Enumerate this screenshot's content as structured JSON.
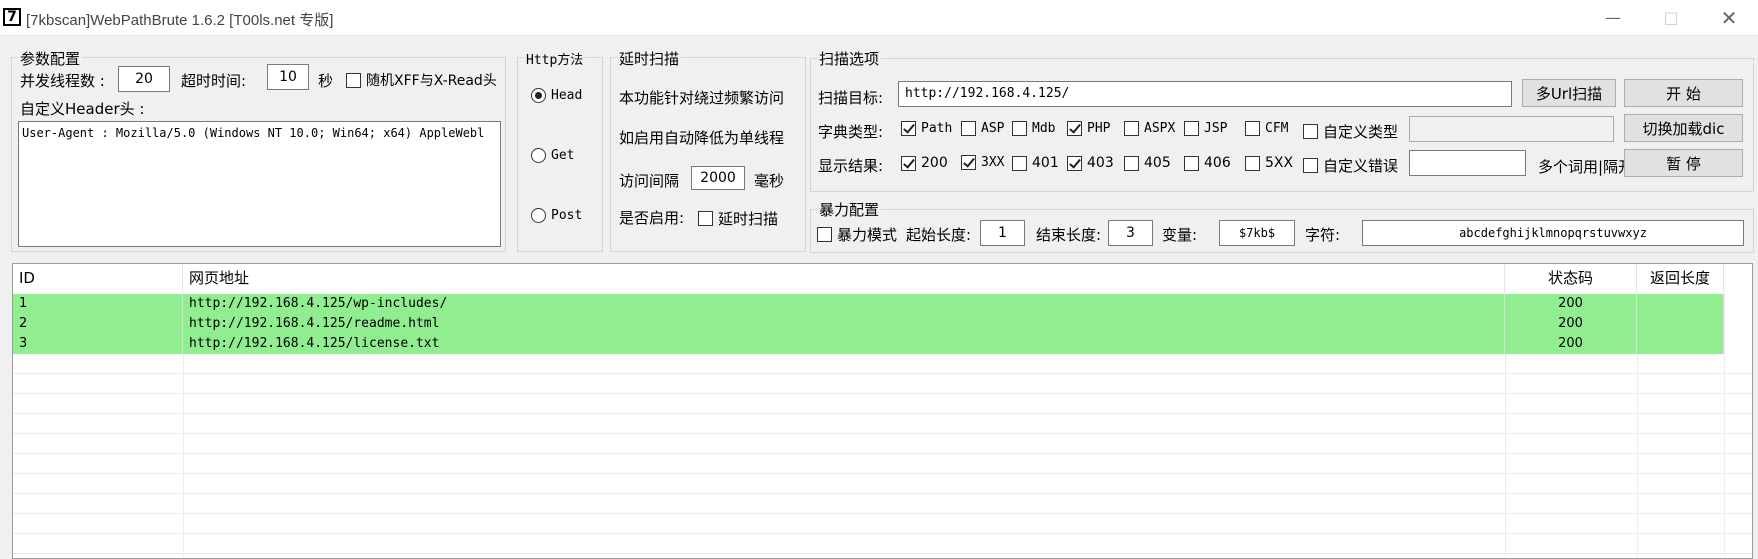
{
  "window": {
    "app_icon": "7",
    "title": "[7kbscan]WebPathBrute 1.6.2 [T00ls.net 专版]"
  },
  "params": {
    "group_label": "参数配置",
    "threads_label": "并发线程数 :",
    "threads_value": "20",
    "timeout_label": "超时时间:",
    "timeout_value": "10",
    "timeout_unit": "秒",
    "random_xff_label": "随机XFF与X-Read头",
    "random_xff_checked": false,
    "header_label": "自定义Header头 :",
    "header_value": "User-Agent : Mozilla/5.0 (Windows NT 10.0; Win64; x64) AppleWebl"
  },
  "http_method": {
    "group_label": "Http方法",
    "options": [
      {
        "label": "Head",
        "selected": true
      },
      {
        "label": "Get",
        "selected": false
      },
      {
        "label": "Post",
        "selected": false
      }
    ]
  },
  "delay": {
    "group_label": "延时扫描",
    "desc1": "本功能针对绕过频繁访问",
    "desc2": "如启用自动降低为单线程",
    "interval_label": "访问间隔",
    "interval_value": "2000",
    "interval_unit": "毫秒",
    "enable_label": "是否启用:",
    "enable_checkbox_label": "延时扫描",
    "enabled": false
  },
  "scan": {
    "group_label": "扫描选项",
    "target_label": "扫描目标:",
    "target_value": "http://192.168.4.125/",
    "multi_url_button": "多Url扫描",
    "start_button": "开 始",
    "dict_label": "字典类型:",
    "dict_types": [
      {
        "label": "Path",
        "checked": true
      },
      {
        "label": "ASP",
        "checked": false
      },
      {
        "label": "Mdb",
        "checked": false
      },
      {
        "label": "PHP",
        "checked": true
      },
      {
        "label": "ASPX",
        "checked": false
      },
      {
        "label": "JSP",
        "checked": false
      },
      {
        "label": "CFM",
        "checked": false
      },
      {
        "label": "自定义类型",
        "checked": false
      }
    ],
    "custom_type_value": "",
    "switch_dic_button": "切换加载dic",
    "result_label": "显示结果:",
    "result_codes": [
      {
        "label": "200",
        "checked": true
      },
      {
        "label": "3XX",
        "checked": true
      },
      {
        "label": "401",
        "checked": false
      },
      {
        "label": "403",
        "checked": true
      },
      {
        "label": "405",
        "checked": false
      },
      {
        "label": "406",
        "checked": false
      },
      {
        "label": "5XX",
        "checked": false
      },
      {
        "label": "自定义错误",
        "checked": false
      }
    ],
    "custom_error_value": "",
    "multi_word_label": "多个词用|隔开",
    "pause_button": "暂 停"
  },
  "brute": {
    "group_label": "暴力配置",
    "mode_label": "暴力模式",
    "mode_checked": false,
    "start_len_label": "起始长度:",
    "start_len_value": "1",
    "end_len_label": "结束长度:",
    "end_len_value": "3",
    "var_label": "变量:",
    "var_value": "$7kb$",
    "chars_label": "字符:",
    "chars_value": "abcdefghijklmnopqrstuvwxyz"
  },
  "results": {
    "columns": [
      "ID",
      "网页地址",
      "状态码",
      "返回长度"
    ],
    "rows": [
      {
        "id": "1",
        "url": "http://192.168.4.125/wp-includes/",
        "status": "200",
        "length": ""
      },
      {
        "id": "2",
        "url": "http://192.168.4.125/readme.html",
        "status": "200",
        "length": ""
      },
      {
        "id": "3",
        "url": "http://192.168.4.125/license.txt",
        "status": "200",
        "length": ""
      }
    ],
    "highlight_color": "#90ee90"
  }
}
